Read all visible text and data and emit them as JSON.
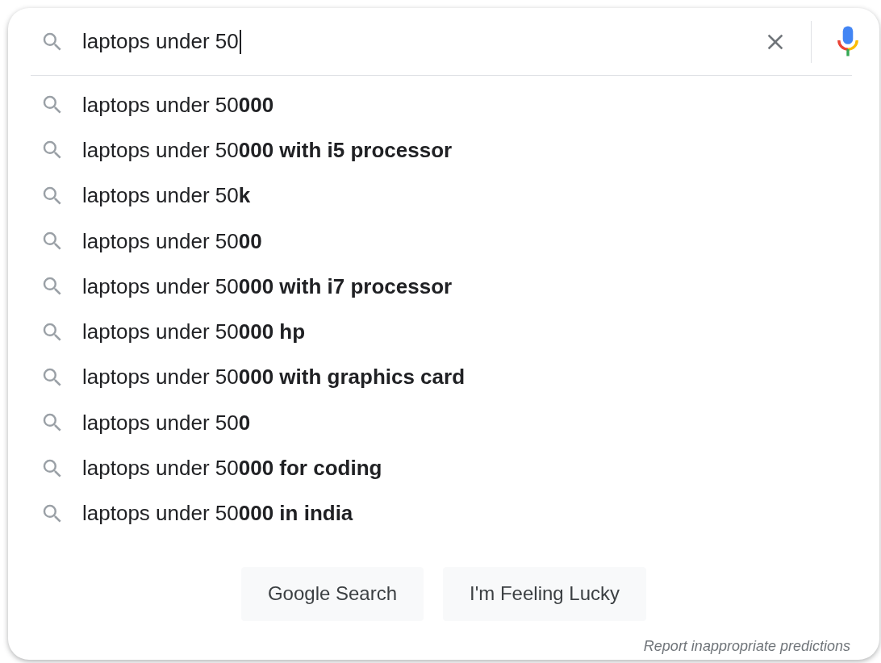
{
  "search": {
    "value": "laptops under 50"
  },
  "suggestions": [
    {
      "text": "laptops under 50**000**"
    },
    {
      "text": "laptops under 50**000 with i5 processor**"
    },
    {
      "text": "laptops under 50**k**"
    },
    {
      "text": "laptops under 50**00**"
    },
    {
      "text": "laptops under 50**000 with i7 processor**"
    },
    {
      "text": "laptops under 50**000 hp**"
    },
    {
      "text": "laptops under 50**000 with graphics card**"
    },
    {
      "text": "laptops under 50**0**"
    },
    {
      "text": "laptops under 50**000 for coding**"
    },
    {
      "text": "laptops under 50**000 in india**"
    }
  ],
  "buttons": [
    "Google Search",
    "I'm Feeling Lucky"
  ],
  "footer_link": "Report inappropriate predictions"
}
